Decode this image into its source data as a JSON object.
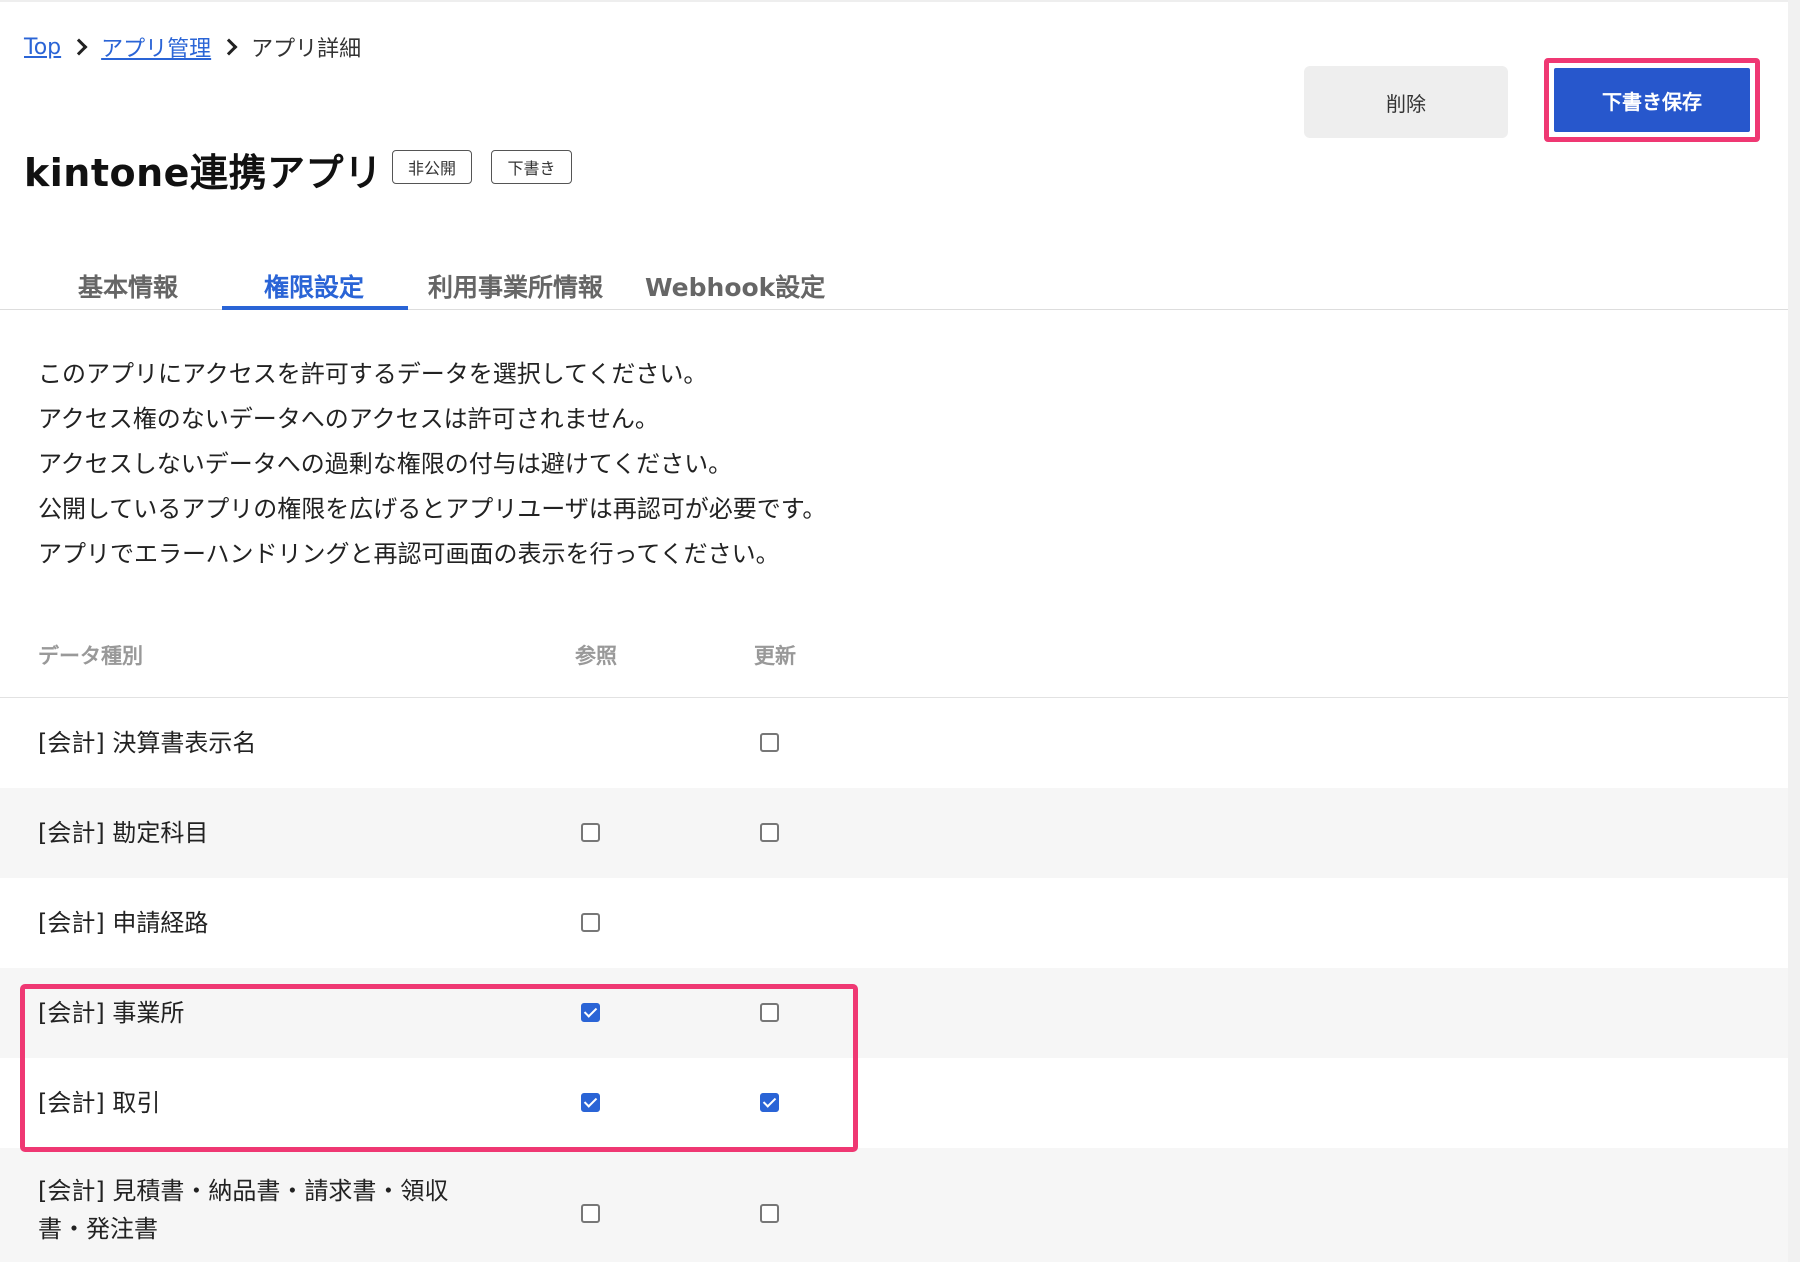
{
  "breadcrumb": {
    "top": "Top",
    "app_management": "アプリ管理",
    "current": "アプリ詳細"
  },
  "actions": {
    "delete_label": "削除",
    "save_draft_label": "下書き保存"
  },
  "app": {
    "title": "kintone連携アプリ",
    "badges": [
      "非公開",
      "下書き"
    ]
  },
  "tabs": [
    {
      "label": "基本情報",
      "active": false
    },
    {
      "label": "権限設定",
      "active": true
    },
    {
      "label": "利用事業所情報",
      "active": false
    },
    {
      "label": "Webhook設定",
      "active": false
    }
  ],
  "description": [
    "このアプリにアクセスを許可するデータを選択してください。",
    "アクセス権のないデータへのアクセスは許可されません。",
    "アクセスしないデータへの過剰な権限の付与は避けてください。",
    "公開しているアプリの権限を広げるとアプリユーザは再認可が必要です。",
    "アプリでエラーハンドリングと再認可画面の表示を行ってください。"
  ],
  "table": {
    "headers": {
      "type": "データ種別",
      "read": "参照",
      "update": "更新"
    },
    "rows": [
      {
        "label": "[会計] 決算書表示名",
        "read": null,
        "update": false
      },
      {
        "label": "[会計] 勘定科目",
        "read": false,
        "update": false
      },
      {
        "label": "[会計] 申請経路",
        "read": false,
        "update": null
      },
      {
        "label": "[会計] 事業所",
        "read": true,
        "update": false
      },
      {
        "label": "[会計] 取引",
        "read": true,
        "update": true
      },
      {
        "label_line1": "[会計] 見積書・納品書・請求書・領収",
        "label_line2": "書・発注書",
        "read": false,
        "update": false
      }
    ]
  },
  "colors": {
    "accent": "#2a64d6",
    "save_button": "#2757cc",
    "highlight": "#ef3873"
  }
}
